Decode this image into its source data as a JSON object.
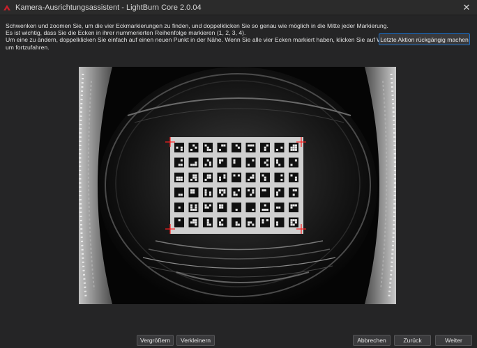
{
  "window": {
    "title": "Kamera-Ausrichtungsassistent - LightBurn Core 2.0.04",
    "close_glyph": "✕",
    "icons": {
      "app": "lightburn-logo-icon",
      "close": "close-icon"
    }
  },
  "instructions": {
    "lines": [
      "Schwenken und zoomen Sie, um die vier Eckmarkierungen zu finden, und doppelklicken Sie so genau wie möglich in die Mitte jeder Markierung.",
      "Es ist wichtig, dass Sie die Ecken in ihrer nummerierten Reihenfolge markieren (1, 2, 3, 4).",
      "Um eine zu ändern, doppelklicken Sie einfach auf einen neuen Punkt in der Nähe. Wenn Sie alle vier Ecken markiert haben, klicken Sie auf Weiter,",
      "um fortzufahren."
    ]
  },
  "toolbar": {
    "undo_label": "Letzte Aktion rückgängig machen"
  },
  "camera": {
    "marker_color": "#ff2020",
    "markers_placed": 4,
    "icons": {
      "marker": "crosshair-marker-icon"
    }
  },
  "bottom": {
    "zoom_in_label": "Vergrößern",
    "zoom_out_label": "Verkleinern",
    "cancel_label": "Abbrechen",
    "back_label": "Zurück",
    "next_label": "Weiter"
  },
  "colors": {
    "background": "#252526",
    "button_bg": "#3a3a3c",
    "focus_border": "#1b6fc7",
    "app_icon": "#c8202a"
  }
}
